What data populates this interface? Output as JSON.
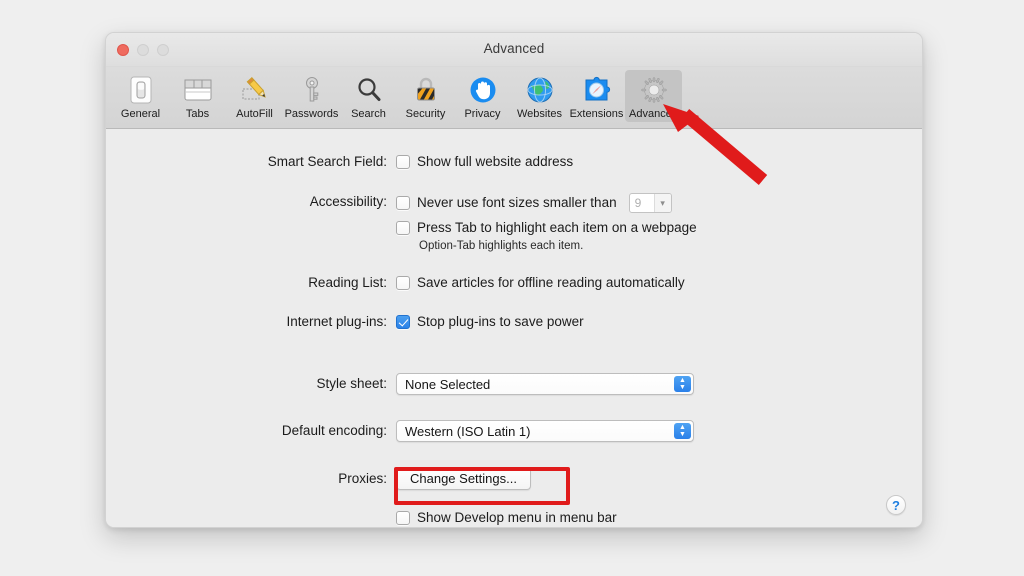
{
  "window": {
    "title": "Advanced",
    "traffic_lights": [
      "close",
      "minimize",
      "maximize"
    ]
  },
  "toolbar": {
    "selected": "Advanced",
    "tabs": [
      {
        "label": "General",
        "icon": "general-switch-icon"
      },
      {
        "label": "Tabs",
        "icon": "tabs-window-icon"
      },
      {
        "label": "AutoFill",
        "icon": "autofill-pencil-icon"
      },
      {
        "label": "Passwords",
        "icon": "passwords-key-icon"
      },
      {
        "label": "Search",
        "icon": "search-magnifier-icon"
      },
      {
        "label": "Security",
        "icon": "security-padlock-icon"
      },
      {
        "label": "Privacy",
        "icon": "privacy-hand-icon"
      },
      {
        "label": "Websites",
        "icon": "websites-globe-icon"
      },
      {
        "label": "Extensions",
        "icon": "extensions-puzzle-icon"
      },
      {
        "label": "Advanced",
        "icon": "advanced-gear-icon"
      }
    ]
  },
  "settings": {
    "smart_search": {
      "label": "Smart Search Field:",
      "checkbox_label": "Show full website address",
      "checked": false
    },
    "accessibility": {
      "label": "Accessibility:",
      "font_size_label": "Never use font sizes smaller than",
      "font_size_checked": false,
      "font_size_value": "9",
      "tab_highlight_label": "Press Tab to highlight each item on a webpage",
      "tab_highlight_checked": false,
      "note": "Option-Tab highlights each item."
    },
    "reading_list": {
      "label": "Reading List:",
      "checkbox_label": "Save articles for offline reading automatically",
      "checked": false
    },
    "plugins": {
      "label": "Internet plug-ins:",
      "checkbox_label": "Stop plug-ins to save power",
      "checked": true
    },
    "style_sheet": {
      "label": "Style sheet:",
      "value": "None Selected"
    },
    "default_encoding": {
      "label": "Default encoding:",
      "value": "Western (ISO Latin 1)"
    },
    "proxies": {
      "label": "Proxies:",
      "button_label": "Change Settings..."
    },
    "develop_menu": {
      "checkbox_label": "Show Develop menu in menu bar",
      "checked": false
    }
  },
  "help": {
    "label": "?"
  },
  "annotations": {
    "arrow_color": "#e01b1b",
    "highlight_color": "#e01b1b",
    "arrow_target": "Advanced",
    "highlight_target": "Change Settings..."
  }
}
